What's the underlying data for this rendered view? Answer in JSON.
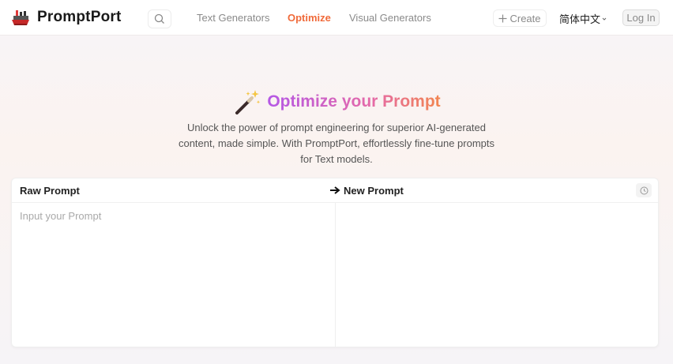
{
  "header": {
    "brand": "PromptPort",
    "nav": [
      {
        "label": "Text Generators",
        "active": false
      },
      {
        "label": "Optimize",
        "active": true
      },
      {
        "label": "Visual Generators",
        "active": false
      }
    ],
    "create_label": "Create",
    "language": "简体中文",
    "login_label": "Log In",
    "icons": {
      "logo": "ship-logo-icon",
      "search": "search-icon",
      "create": "plus-icon",
      "language": "chevron-down-icon"
    }
  },
  "hero": {
    "title": "Optimize your Prompt",
    "description": "Unlock the power of prompt engineering for superior AI-generated content, made simple. With PromptPort, effortlessly fine-tune prompts for Text models.",
    "icon": "magic-wand-icon"
  },
  "editor": {
    "raw_label": "Raw Prompt",
    "new_label": "New Prompt",
    "input_placeholder": "Input your Prompt",
    "input_value": "",
    "output_value": "",
    "icons": {
      "arrow": "arrow-right-icon",
      "history": "history-clock-icon"
    }
  },
  "colors": {
    "accent": "#f06a3a",
    "title_gradient_start": "#b457e6",
    "title_gradient_end": "#f2854f"
  }
}
